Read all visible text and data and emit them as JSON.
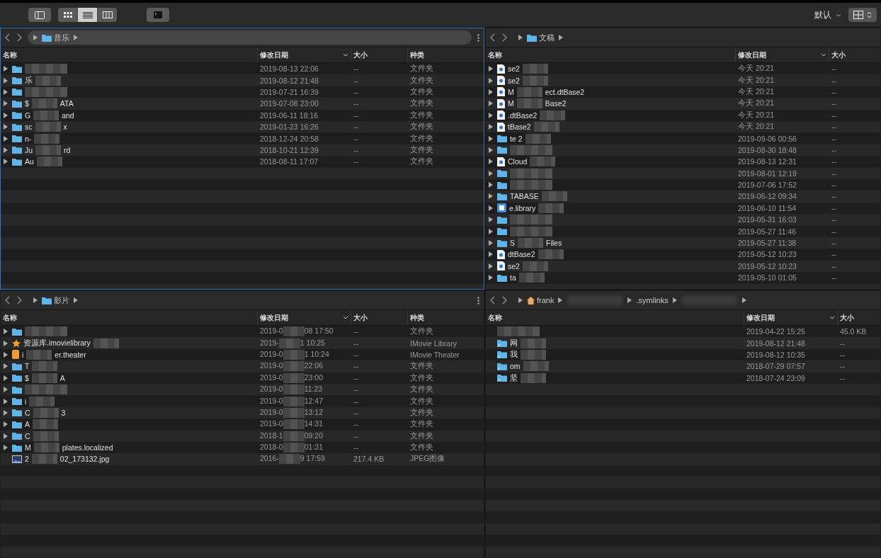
{
  "toolbar": {
    "sidebar_toggle": {
      "on": false
    },
    "views": [
      {
        "kind": "icons",
        "selected": false
      },
      {
        "kind": "list",
        "selected": true
      },
      {
        "kind": "columns",
        "selected": false
      }
    ],
    "sort_label": "默认"
  },
  "panes": [
    {
      "focused": true,
      "menu": true,
      "path": [
        {
          "kind": "music",
          "label": "音乐"
        }
      ],
      "columns": [
        "名称",
        "修改日期",
        "大小",
        "种类"
      ],
      "rows": [
        {
          "kind": "folder",
          "expandable": true,
          "date": [
            "2019-08-13 22:06"
          ],
          "size": "--",
          "type": "文件夹"
        },
        {
          "kind": "folder",
          "expandable": true,
          "name": [
            "乐"
          ],
          "date": [
            "2019-08-12 21:48"
          ],
          "size": "--",
          "type": "文件夹"
        },
        {
          "kind": "folder",
          "expandable": true,
          "date": [
            "2019-07-21 16:39"
          ],
          "size": "--",
          "type": "文件夹"
        },
        {
          "kind": "folder",
          "expandable": true,
          "name": [
            "$",
            "ATA"
          ],
          "date": [
            "2019-07-08 23:00"
          ],
          "size": "--",
          "type": "文件夹"
        },
        {
          "kind": "folder",
          "expandable": true,
          "name": [
            "G",
            "and"
          ],
          "date": [
            "2019-06-11 18:16"
          ],
          "size": "--",
          "type": "文件夹"
        },
        {
          "kind": "folder",
          "expandable": true,
          "name": [
            "sc",
            "x"
          ],
          "date": [
            "2019-01-23 16:26"
          ],
          "size": "--",
          "type": "文件夹"
        },
        {
          "kind": "folder",
          "expandable": true,
          "name": [
            "n-"
          ],
          "date": [
            "2018-12-24 20:58"
          ],
          "size": "--",
          "type": "文件夹"
        },
        {
          "kind": "folder",
          "expandable": true,
          "name": [
            "Ju",
            "rd"
          ],
          "date": [
            "2018-10-21 12:39"
          ],
          "size": "--",
          "type": "文件夹"
        },
        {
          "kind": "folder",
          "expandable": true,
          "name": [
            "Au"
          ],
          "date": [
            "2018-08-11 17:07"
          ],
          "size": "--",
          "type": "文件夹"
        }
      ]
    },
    {
      "focused": false,
      "menu": false,
      "path": [
        {
          "kind": "docs",
          "label": "文稿"
        }
      ],
      "columns": [
        "名称",
        "修改日期",
        "大小"
      ],
      "rows": [
        {
          "kind": "doc",
          "expandable": true,
          "name": [
            "se2"
          ],
          "date": [
            "今天 20:21"
          ],
          "size": "--"
        },
        {
          "kind": "doc",
          "expandable": true,
          "name": [
            "se2"
          ],
          "date": [
            "今天 20:21"
          ],
          "size": "--"
        },
        {
          "kind": "doc",
          "expandable": true,
          "name": [
            "M",
            "ect.dtBase2"
          ],
          "date": [
            "今天 20:21"
          ],
          "size": "--"
        },
        {
          "kind": "doc",
          "expandable": true,
          "name": [
            "M",
            "Base2"
          ],
          "date": [
            "今天 20:21"
          ],
          "size": "--"
        },
        {
          "kind": "doc",
          "expandable": true,
          "name": [
            ".dtBase2"
          ],
          "date": [
            "今天 20:21"
          ],
          "size": "--"
        },
        {
          "kind": "doc",
          "expandable": true,
          "name": [
            "tBase2"
          ],
          "date": [
            "今天 20:21"
          ],
          "size": "--"
        },
        {
          "kind": "folder",
          "expandable": true,
          "name": [
            "te 2"
          ],
          "date": [
            "2019-09-06 00:56"
          ],
          "size": "--"
        },
        {
          "kind": "folder",
          "expandable": true,
          "date": [
            "2019-08-30 18:48"
          ],
          "size": "--"
        },
        {
          "kind": "doc",
          "expandable": true,
          "name": [
            "Cloud"
          ],
          "date": [
            "2019-08-13 12:31"
          ],
          "size": "--"
        },
        {
          "kind": "folder",
          "expandable": true,
          "date": [
            "2019-08-01 12:19"
          ],
          "size": "--"
        },
        {
          "kind": "folder",
          "expandable": true,
          "date": [
            "2019-07-06 17:52"
          ],
          "size": "--"
        },
        {
          "kind": "folder",
          "expandable": true,
          "name": [
            "TABASE"
          ],
          "date": [
            "2019-06-12 09:34"
          ],
          "size": "--"
        },
        {
          "kind": "app",
          "expandable": true,
          "name": [
            "e.library"
          ],
          "date": [
            "2019-06-10 11:54"
          ],
          "size": "--"
        },
        {
          "kind": "folder",
          "expandable": true,
          "date": [
            "2019-05-31 16:03"
          ],
          "size": "--"
        },
        {
          "kind": "folder",
          "expandable": true,
          "date": [
            "2019-05-27 11:46"
          ],
          "size": "--"
        },
        {
          "kind": "folder",
          "expandable": true,
          "name": [
            "S",
            "Files"
          ],
          "date": [
            "2019-05-27 11:38"
          ],
          "size": "--"
        },
        {
          "kind": "doc",
          "expandable": true,
          "name": [
            "dtBase2"
          ],
          "date": [
            "2019-05-12 10:23"
          ],
          "size": "--"
        },
        {
          "kind": "doc",
          "expandable": true,
          "name": [
            "se2"
          ],
          "date": [
            "2019-05-12 10:23"
          ],
          "size": "--"
        },
        {
          "kind": "folder",
          "expandable": true,
          "name": [
            "ta"
          ],
          "date": [
            "2019-05-10 01:05"
          ],
          "size": "--"
        }
      ]
    },
    {
      "focused": false,
      "menu": true,
      "path": [
        {
          "kind": "movies",
          "label": "影片"
        }
      ],
      "columns": [
        "名称",
        "修改日期",
        "大小",
        "种类"
      ],
      "rows": [
        {
          "kind": "folder",
          "expandable": true,
          "date": [
            "2019-0",
            "08 17:50"
          ],
          "size": "--",
          "type": "文件夹"
        },
        {
          "kind": "imovie",
          "expandable": true,
          "name": [
            "资源库.imovielibrary"
          ],
          "date": [
            "2019-",
            "1 10:25"
          ],
          "size": "--",
          "type": "IMovie Library"
        },
        {
          "kind": "theater",
          "expandable": true,
          "name": [
            "i",
            "er.theater"
          ],
          "date": [
            "2019-0",
            "1 10:24"
          ],
          "size": "--",
          "type": "IMovie Theater"
        },
        {
          "kind": "folder",
          "expandable": true,
          "name": [
            "T"
          ],
          "date": [
            "2019-0",
            "22:06"
          ],
          "size": "--",
          "type": "文件夹"
        },
        {
          "kind": "folder",
          "expandable": true,
          "name": [
            "$",
            "A"
          ],
          "date": [
            "2019-0",
            "23:00"
          ],
          "size": "--",
          "type": "文件夹"
        },
        {
          "kind": "folder",
          "expandable": true,
          "date": [
            "2019-0",
            "11:23"
          ],
          "size": "--",
          "type": "文件夹"
        },
        {
          "kind": "folder",
          "expandable": true,
          "name": [
            "i"
          ],
          "date": [
            "2019-0",
            "12:47"
          ],
          "size": "--",
          "type": "文件夹"
        },
        {
          "kind": "folder",
          "expandable": true,
          "name": [
            "C",
            "3"
          ],
          "date": [
            "2019-0",
            "13:12"
          ],
          "size": "--",
          "type": "文件夹"
        },
        {
          "kind": "folder",
          "expandable": true,
          "name": [
            "A"
          ],
          "date": [
            "2019-0",
            "14:31"
          ],
          "size": "--",
          "type": "文件夹"
        },
        {
          "kind": "folder",
          "expandable": true,
          "name": [
            "C"
          ],
          "date": [
            "2018-1",
            "09:20"
          ],
          "size": "--",
          "type": "文件夹"
        },
        {
          "kind": "folder",
          "expandable": true,
          "name": [
            "M",
            "plates.localized"
          ],
          "date": [
            "2018-0",
            "01:31"
          ],
          "size": "--",
          "type": "文件夹"
        },
        {
          "kind": "image",
          "expandable": false,
          "name": [
            "2",
            "02_173132.jpg"
          ],
          "date": [
            "2016-",
            "9 17:59"
          ],
          "size": "217.4 KB",
          "type": "JPEG图像"
        }
      ]
    },
    {
      "focused": false,
      "menu": false,
      "path": [
        {
          "kind": "home",
          "label": "frank"
        },
        {
          "kind": "hidden"
        },
        {
          "kind": "plain",
          "label": ".symlinks"
        },
        {
          "kind": "hidden"
        }
      ],
      "columns": [
        "名称",
        "修改日期",
        "大小"
      ],
      "rows": [
        {
          "kind": "blank",
          "expandable": false,
          "date": [
            "2019-04-22 15:25"
          ],
          "size": "45.0 KB"
        },
        {
          "kind": "alias",
          "expandable": false,
          "name": [
            "网"
          ],
          "date": [
            "2019-08-12 21:48"
          ],
          "size": "--"
        },
        {
          "kind": "alias",
          "expandable": false,
          "name": [
            "我"
          ],
          "date": [
            "2019-08-12 10:35"
          ],
          "size": "--"
        },
        {
          "kind": "alias",
          "expandable": false,
          "name": [
            "om"
          ],
          "date": [
            "2018-07-29 07:57"
          ],
          "size": "--"
        },
        {
          "kind": "alias",
          "expandable": false,
          "name": [
            "坚"
          ],
          "date": [
            "2018-07-24 23:09"
          ],
          "size": "--"
        }
      ]
    }
  ]
}
